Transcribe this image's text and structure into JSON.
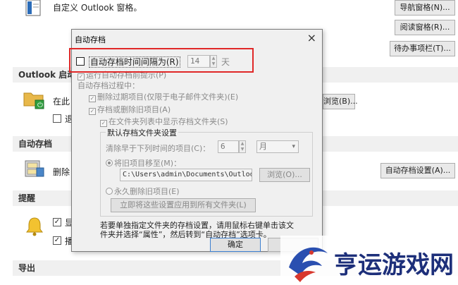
{
  "background": {
    "custom_pane_text": "自定义 Outlook 窗格。",
    "nav_button": "导航窗格(N)...",
    "reading_button": "阅读窗格(R)...",
    "todo_button": "待办事项栏(T)...",
    "outlook_start_head": "Outlook 启动",
    "start_text": "在此",
    "start_text2": "退",
    "browse_button": "浏览(B)...",
    "autoarchive_head": "自动存档",
    "delete_text": "删除",
    "autoarchive_settings_button": "自动存档设置(A)...",
    "reminders_head": "提醒",
    "rem_text1": "显",
    "rem_text2": "播",
    "export_head": "导出"
  },
  "dialog": {
    "title": "自动存档",
    "close": "×",
    "run_every_label": "自动存档时间间隔为(R)",
    "days_value": "14",
    "days_unit": "天",
    "prompt_label": "运行自动存档前提示(P)",
    "during_label": "自动存档过程中：",
    "delete_expired_label": "删除过期项目(仅限于电子邮件文件夹)(E)",
    "archive_old_label": "存档或删除旧项目(A)",
    "show_folder_label": "在文件夹列表中显示存档文件夹(S)",
    "default_group_label": "默认存档文件夹设置",
    "clean_older_label": "清除早于下列时间的项目(C)：",
    "clean_value": "6",
    "clean_unit": "月",
    "move_to_label": "将旧项目移至(M)：",
    "path_value": "C:\\Users\\admin\\Documents\\Outloo",
    "browse_label": "浏览(O)...",
    "perm_delete_label": "永久删除旧项目(E)",
    "apply_all_label": "立即将这些设置应用到所有文件夹(L)",
    "note_line1": "若要单独指定文件夹的存档设置，请用鼠标右键单击该文",
    "note_line2": "件夹并选择“属性”，然后转到“自动存档”选项卡。",
    "ok_label": "确定"
  },
  "watermark": {
    "text": "亨运游戏网"
  }
}
